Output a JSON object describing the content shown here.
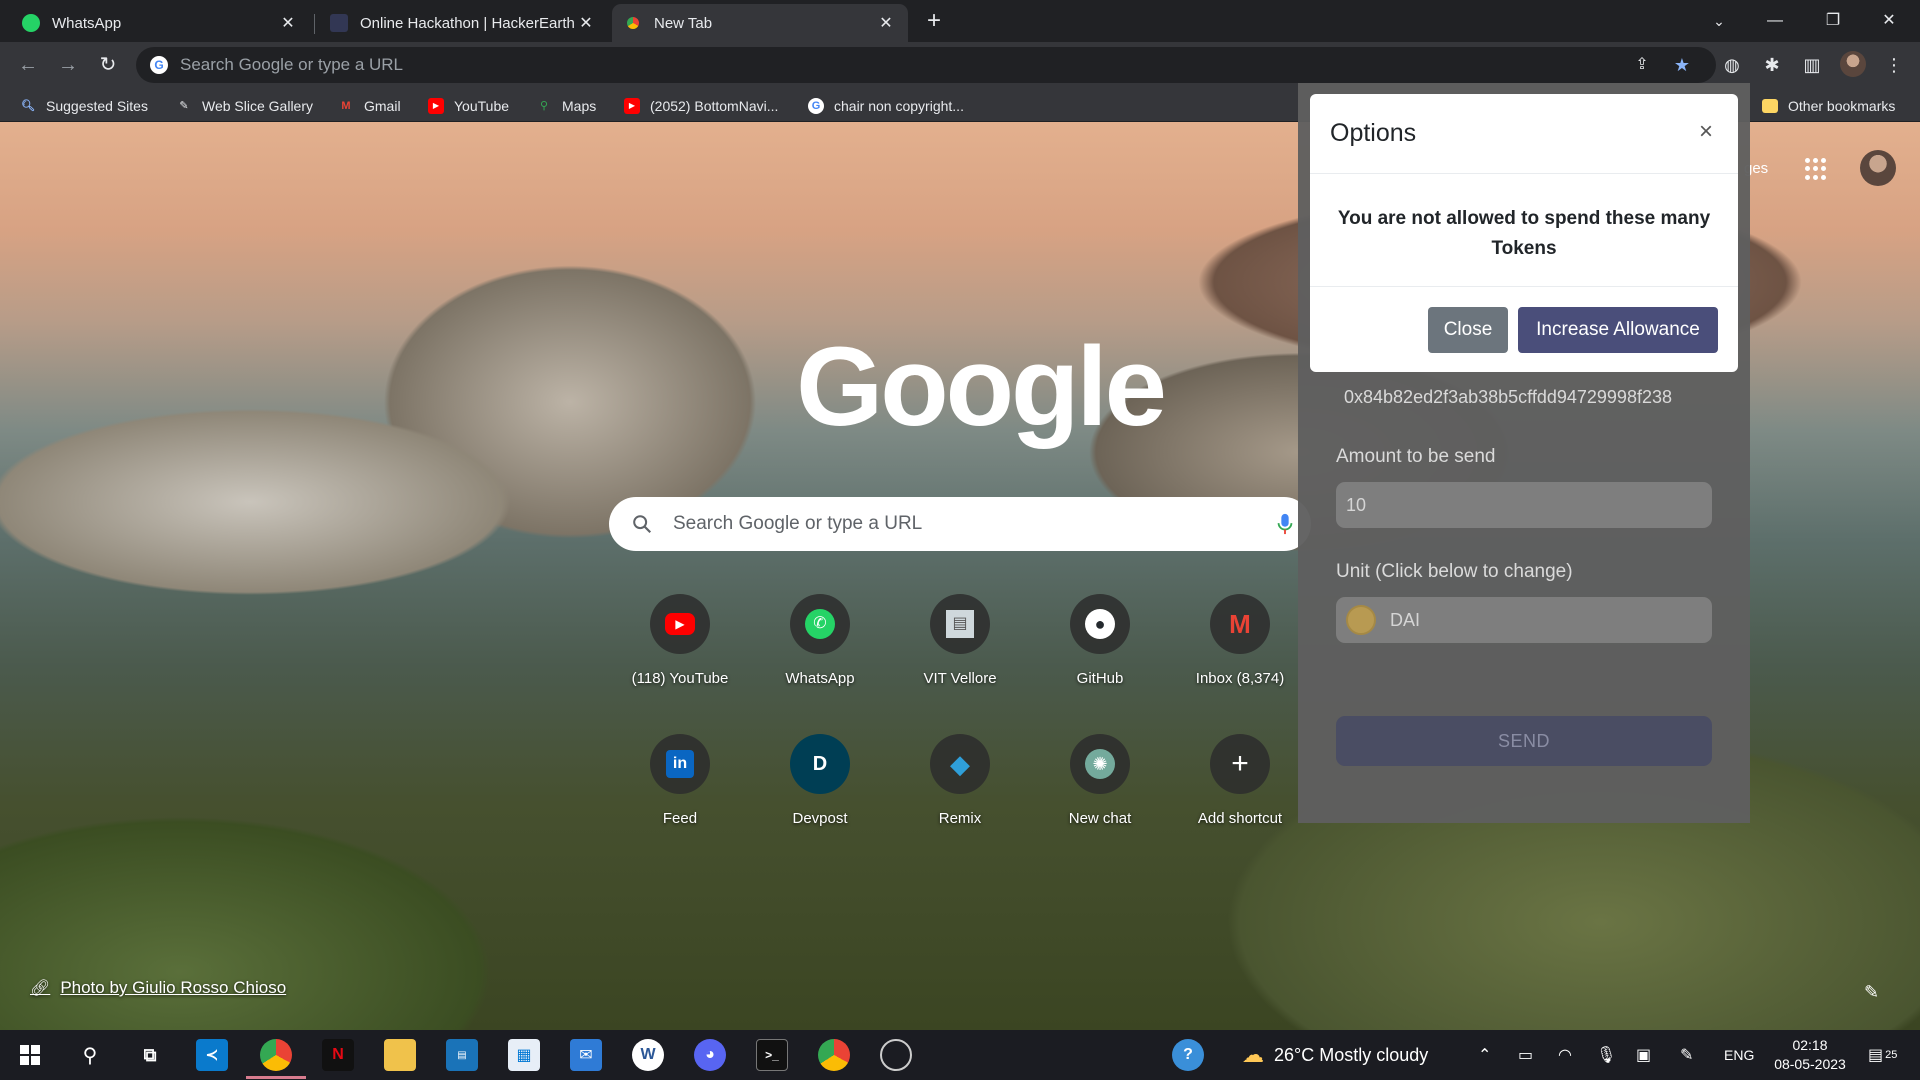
{
  "browser": {
    "tabs": [
      {
        "title": "WhatsApp",
        "icon": "whatsapp-icon",
        "active": false
      },
      {
        "title": "Online Hackathon | HackerEarth",
        "icon": "hackerearth-icon",
        "active": false
      },
      {
        "title": "New Tab",
        "icon": "chrome-icon",
        "active": true
      }
    ],
    "omnibox_placeholder": "Search Google or type a URL",
    "bookmarks": [
      {
        "label": "Suggested Sites",
        "icon": "suggested-sites-icon"
      },
      {
        "label": "Web Slice Gallery",
        "icon": "web-slice-icon"
      },
      {
        "label": "Gmail",
        "icon": "gmail-icon"
      },
      {
        "label": "YouTube",
        "icon": "youtube-icon"
      },
      {
        "label": "Maps",
        "icon": "maps-icon"
      },
      {
        "label": "(2052) BottomNavi...",
        "icon": "youtube-icon"
      },
      {
        "label": "chair non copyright...",
        "icon": "google-icon"
      }
    ],
    "other_bookmarks": "Other bookmarks"
  },
  "ntp": {
    "logo": "Google",
    "search_placeholder": "Search Google or type a URL",
    "images_link": "ges",
    "shortcuts": [
      {
        "label": "(118) YouTube",
        "icon": "youtube-icon",
        "glyph": "▶",
        "color": "#ff0000"
      },
      {
        "label": "WhatsApp",
        "icon": "whatsapp-icon",
        "glyph": "✆",
        "color": "#25d366"
      },
      {
        "label": "VIT Vellore",
        "icon": "vit-icon",
        "glyph": "▤",
        "color": "#cfd8dc"
      },
      {
        "label": "GitHub",
        "icon": "github-icon",
        "glyph": "●",
        "color": "#ffffff"
      },
      {
        "label": "Inbox (8,374)",
        "icon": "gmail-icon",
        "glyph": "M",
        "color": "#ea4335"
      },
      {
        "label": "Feed",
        "icon": "linkedin-icon",
        "glyph": "in",
        "color": "#0a66c2"
      },
      {
        "label": "Devpost",
        "icon": "devpost-icon",
        "glyph": "D",
        "color": "#003e54"
      },
      {
        "label": "Remix",
        "icon": "remix-icon",
        "glyph": "◆",
        "color": "#2f9fd9"
      },
      {
        "label": "New chat",
        "icon": "openai-icon",
        "glyph": "✺",
        "color": "#74aa9c"
      },
      {
        "label": "Add shortcut",
        "icon": "plus-icon",
        "glyph": "+",
        "color": "#ffffff"
      }
    ],
    "photo_credit": "Photo by Giulio Rosso Chioso"
  },
  "extension": {
    "address": "0x84b82ed2f3ab38b5cffdd94729998f238",
    "amount_label": "Amount to be send",
    "amount_value": "10",
    "unit_label": "Unit (Click below to change)",
    "unit_value": "DAI",
    "send_label": "SEND"
  },
  "modal": {
    "title": "Options",
    "close_glyph": "×",
    "message": "You are not allowed to spend these many Tokens",
    "close_button": "Close",
    "increase_button": "Increase Allowance"
  },
  "taskbar": {
    "weather": "26°C  Mostly cloudy",
    "language": "ENG",
    "time": "02:18",
    "date": "08-05-2023",
    "notification_count": "25"
  }
}
